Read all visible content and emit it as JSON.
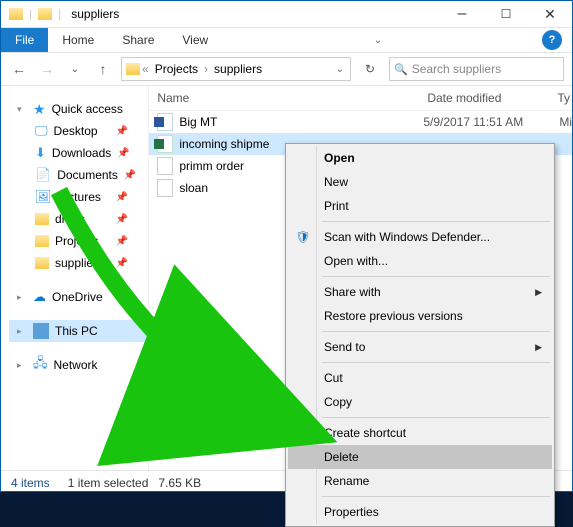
{
  "title": "suppliers",
  "ribbon": {
    "file": "File",
    "tabs": [
      "Home",
      "Share",
      "View"
    ]
  },
  "breadcrumb": {
    "parent": "Projects",
    "current": "suppliers"
  },
  "search": {
    "placeholder": "Search suppliers"
  },
  "sidebar": {
    "quick_access": "Quick access",
    "items": [
      {
        "label": "Desktop",
        "icon": "desktop",
        "pinned": true
      },
      {
        "label": "Downloads",
        "icon": "downloads",
        "pinned": true
      },
      {
        "label": "Documents",
        "icon": "documents",
        "pinned": true
      },
      {
        "label": "Pictures",
        "icon": "pictures",
        "pinned": true
      },
      {
        "label": "drafts",
        "icon": "folder",
        "pinned": true
      },
      {
        "label": "Projects",
        "icon": "folder",
        "pinned": true
      },
      {
        "label": "suppliers",
        "icon": "folder",
        "pinned": true
      }
    ],
    "onedrive": "OneDrive",
    "thispc": "This PC",
    "network": "Network"
  },
  "columns": {
    "name": "Name",
    "date": "Date modified",
    "type": "Ty"
  },
  "files": [
    {
      "name": "Big MT",
      "icon": "word",
      "date": "5/9/2017 11:51 AM",
      "type": "Mi",
      "selected": false
    },
    {
      "name": "incoming shipme",
      "icon": "excel",
      "date": "",
      "type": "",
      "selected": true
    },
    {
      "name": "primm order",
      "icon": "generic",
      "date": "",
      "type": "",
      "selected": false
    },
    {
      "name": "sloan",
      "icon": "generic",
      "date": "",
      "type": "",
      "selected": false
    }
  ],
  "context_menu": {
    "groups": [
      [
        {
          "label": "Open"
        },
        {
          "label": "New"
        },
        {
          "label": "Print"
        }
      ],
      [
        {
          "label": "Scan with Windows Defender...",
          "icon": "shield"
        },
        {
          "label": "Open with...",
          "submenu": false
        }
      ],
      [
        {
          "label": "Share with",
          "submenu": true
        },
        {
          "label": "Restore previous versions"
        }
      ],
      [
        {
          "label": "Send to",
          "submenu": true
        }
      ],
      [
        {
          "label": "Cut"
        },
        {
          "label": "Copy"
        }
      ],
      [
        {
          "label": "Create shortcut"
        },
        {
          "label": "Delete",
          "highlight": true
        },
        {
          "label": "Rename"
        }
      ],
      [
        {
          "label": "Properties"
        }
      ]
    ]
  },
  "statusbar": {
    "count": "4 items",
    "selection": "1 item selected",
    "size": "7.65 KB"
  }
}
